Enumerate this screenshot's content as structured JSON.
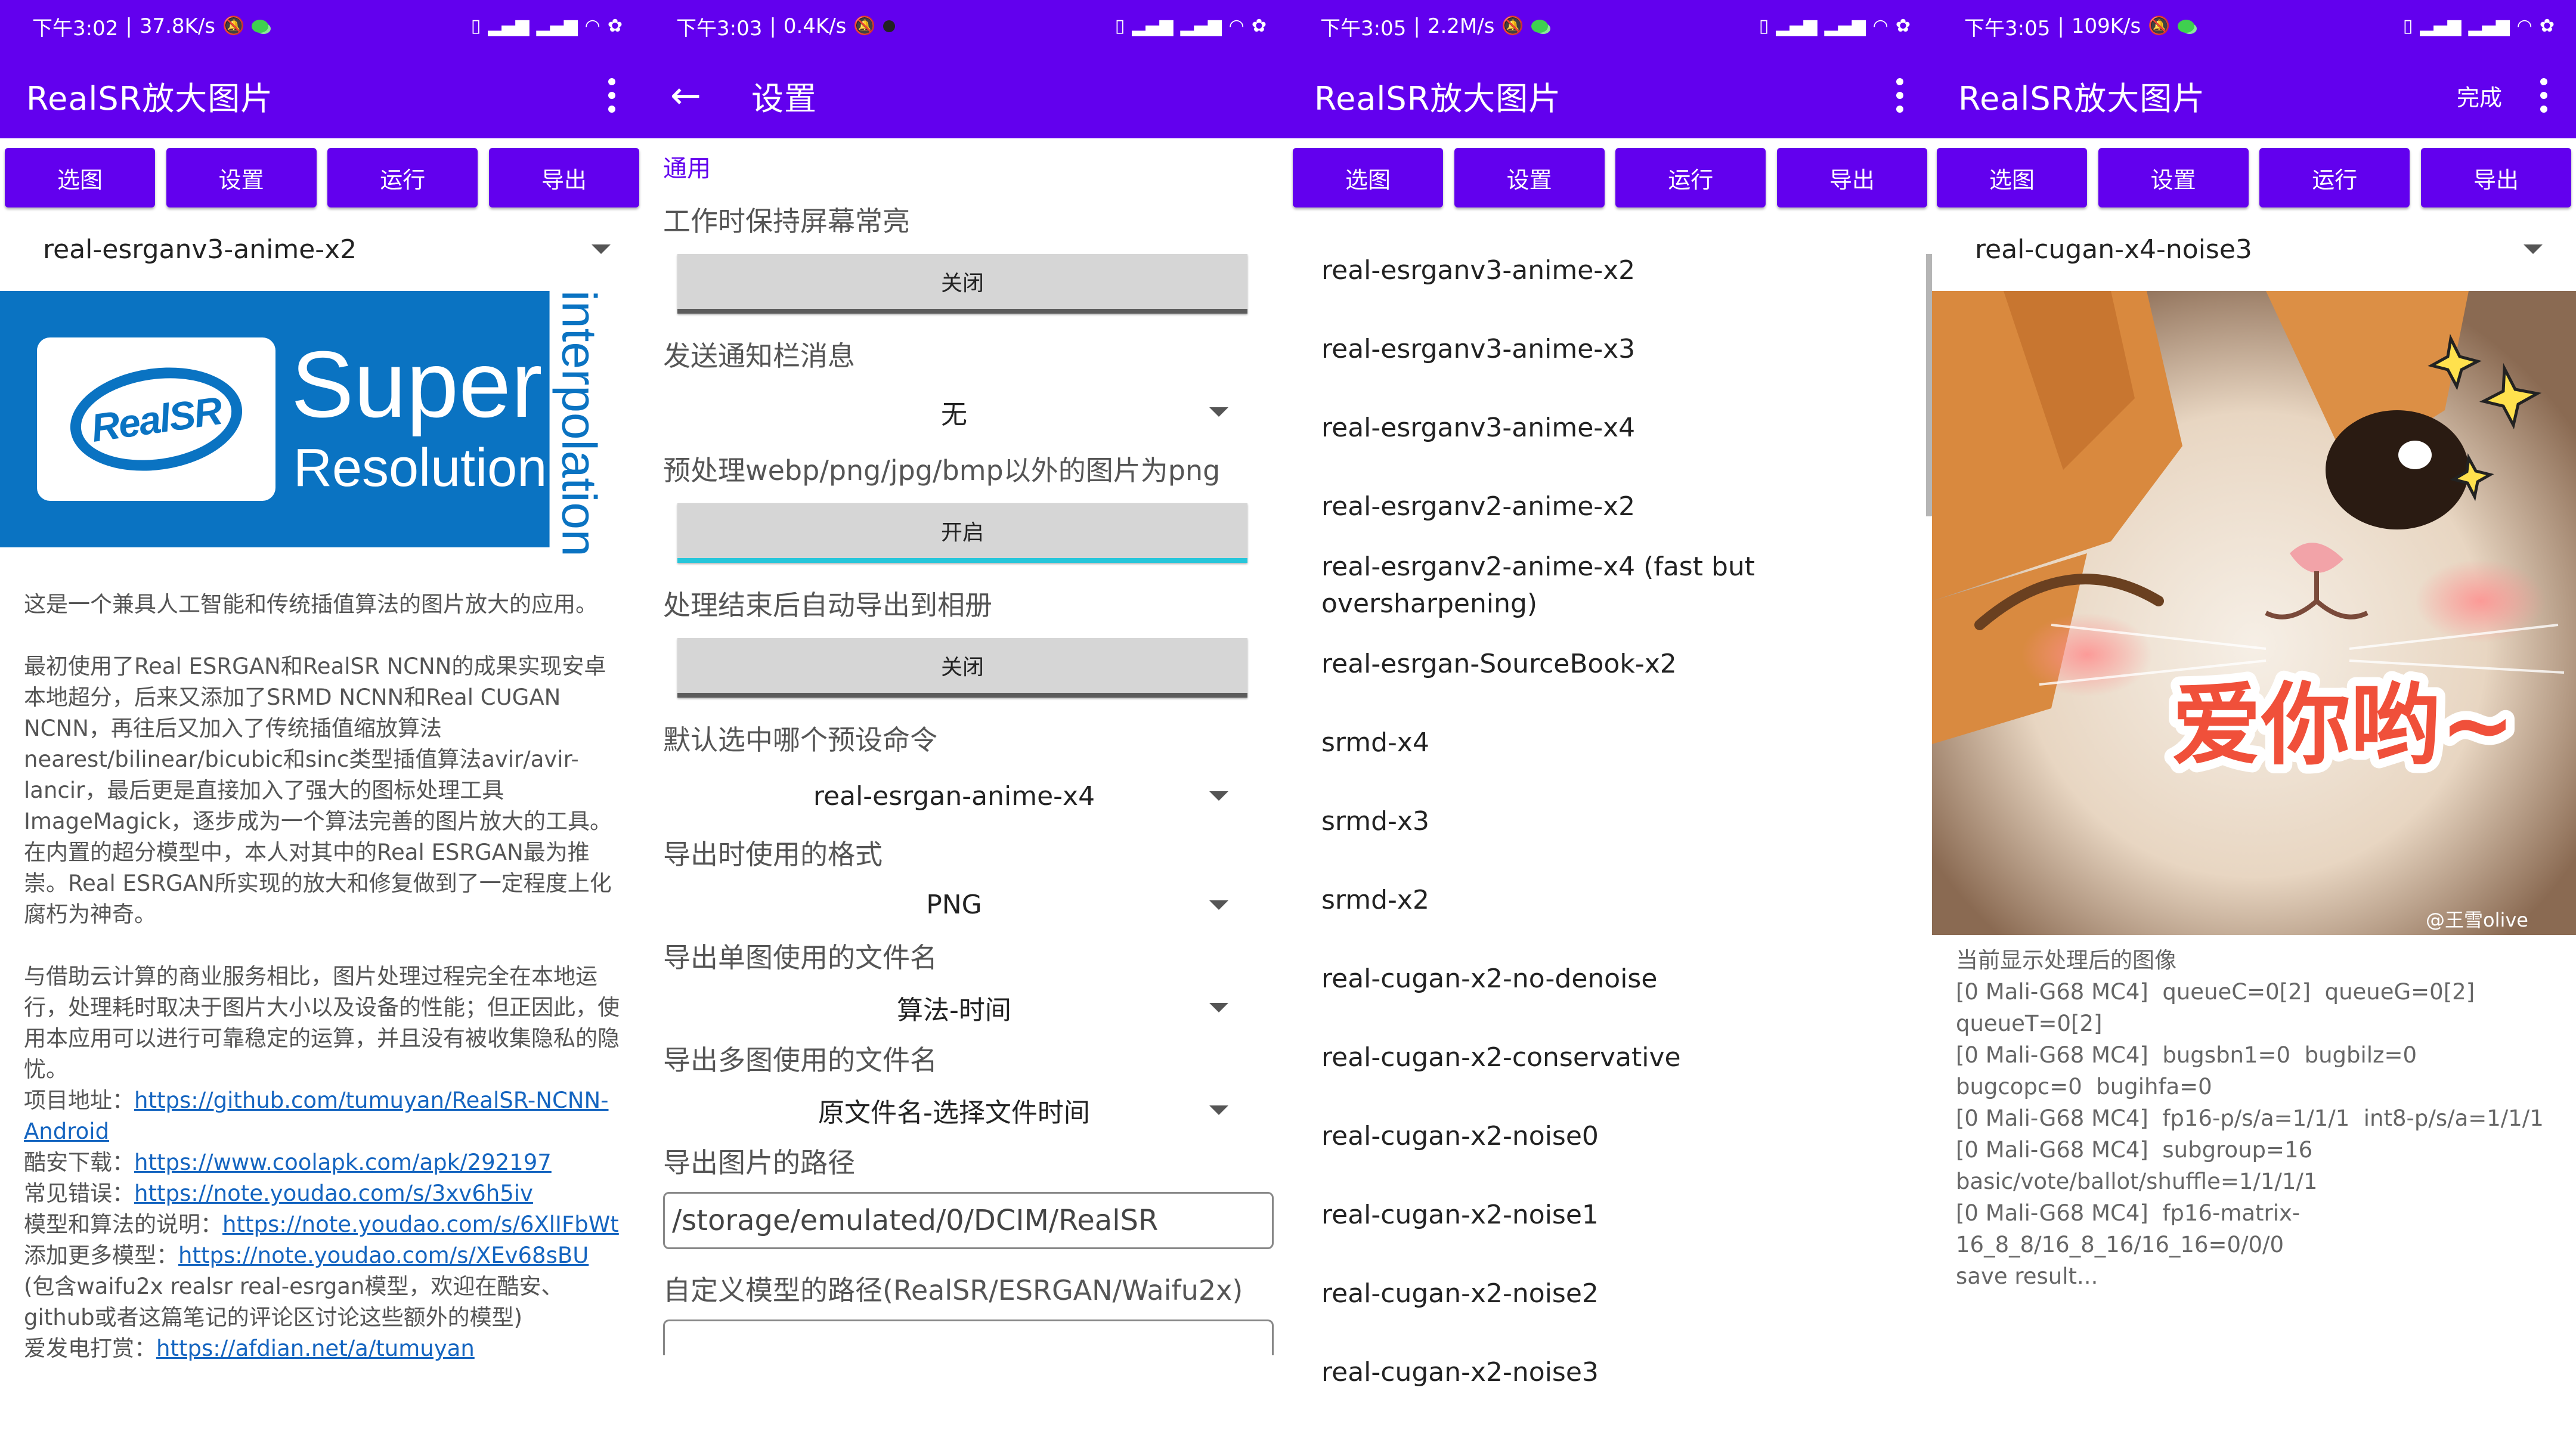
{
  "colors": {
    "primary": "#6200ee",
    "logo_blue": "#0a73c2",
    "link": "#1565c0",
    "toggle_on": "#26c6da"
  },
  "screen1": {
    "status": {
      "time": "下午3:02",
      "speed": "37.8K/s"
    },
    "appbar": {
      "title": "RealSR放大图片"
    },
    "buttons": [
      "选图",
      "设置",
      "运行",
      "导出"
    ],
    "model": "real-esrganv3-anime-x2",
    "logo": {
      "brand": "RealSR",
      "line1": "Super",
      "line2": "Resolution",
      "side": "interpolation"
    },
    "desc": {
      "p1": "这是一个兼具人工智能和传统插值算法的图片放大的应用。",
      "p2a": "最初使用了Real ESRGAN和RealSR NCNN的成果实现安卓本地超分，后来又添加了SRMD NCNN和Real CUGAN NCNN，再往后又加入了传统插值缩放算法nearest/bilinear/bicubic和sinc类型插值算法avir/avir-lancir，最后更是直接加入了强大的图标处理工具ImageMagick，逐步成为一个算法完善的图片放大的工具。",
      "p2b": "在内置的超分模型中，本人对其中的Real ESRGAN最为推崇。Real ESRGAN所实现的放大和修复做到了一定程度上化腐朽为神奇。",
      "p3": "与借助云计算的商业服务相比，图片处理过程完全在本地运行，处理耗时取决于图片大小以及设备的性能；但正因此，使用本应用可以进行可靠稳定的运算，并且没有被收集隐私的隐忧。",
      "l1_label": "项目地址：",
      "l1_url": "https://github.com/tumuyan/RealSR-NCNN-Android",
      "l2_label": "酷安下载：",
      "l2_url": "https://www.coolapk.com/apk/292197",
      "l3_label": "常见错误：",
      "l3_url": "https://note.youdao.com/s/3xv6h5iv",
      "l4_label": "模型和算法的说明：",
      "l4_url": "https://note.youdao.com/s/6XlIFbWt",
      "l5_label": "添加更多模型：",
      "l5_url": "https://note.youdao.com/s/XEv68sBU",
      "p4": "(包含waifu2x realsr real-esrgan模型，欢迎在酷安、github或者这篇笔记的评论区讨论这些额外的模型)",
      "l6_label": "爱发电打赏：",
      "l6_url": "https://afdian.net/a/tumuyan"
    }
  },
  "screen2": {
    "status": {
      "time": "下午3:03",
      "speed": "0.4K/s"
    },
    "appbar": {
      "title": "设置"
    },
    "category": "通用",
    "items": {
      "keep_screen": {
        "title": "工作时保持屏幕常亮",
        "value": "关闭"
      },
      "notify": {
        "title": "发送通知栏消息",
        "value": "无"
      },
      "preprocess": {
        "title": "预处理webp/png/jpg/bmp以外的图片为png",
        "value": "开启"
      },
      "auto_export": {
        "title": "处理结束后自动导出到相册",
        "value": "关闭"
      },
      "default_cmd": {
        "title": "默认选中哪个预设命令",
        "value": "real-esrgan-anime-x4"
      },
      "export_format": {
        "title": "导出时使用的格式",
        "value": "PNG"
      },
      "single_name": {
        "title": "导出单图使用的文件名",
        "value": "算法-时间"
      },
      "multi_name": {
        "title": "导出多图使用的文件名",
        "value": "原文件名-选择文件时间"
      },
      "export_path": {
        "title": "导出图片的路径",
        "value": "/storage/emulated/0/DCIM/RealSR"
      },
      "custom_path": {
        "title": "自定义模型的路径(RealSR/ESRGAN/Waifu2x)"
      }
    }
  },
  "screen3": {
    "status": {
      "time": "下午3:05",
      "speed": "2.2M/s"
    },
    "appbar": {
      "title": "RealSR放大图片"
    },
    "buttons": [
      "选图",
      "设置",
      "运行",
      "导出"
    ],
    "models": [
      "real-esrganv3-anime-x2",
      "real-esrganv3-anime-x3",
      "real-esrganv3-anime-x4",
      "real-esrganv2-anime-x2",
      "real-esrganv2-anime-x4 (fast but oversharpening)",
      "real-esrgan-SourceBook-x2",
      "srmd-x4",
      "srmd-x3",
      "srmd-x2",
      "real-cugan-x2-no-denoise",
      "real-cugan-x2-conservative",
      "real-cugan-x2-noise0",
      "real-cugan-x2-noise1",
      "real-cugan-x2-noise2",
      "real-cugan-x2-noise3"
    ]
  },
  "screen4": {
    "status": {
      "time": "下午3:05",
      "speed": "109K/s"
    },
    "appbar": {
      "title": "RealSR放大图片",
      "done": "完成"
    },
    "buttons": [
      "选图",
      "设置",
      "运行",
      "导出"
    ],
    "model": "real-cugan-x4-noise3",
    "image": {
      "caption": "爱你哟~",
      "watermark": "@王雪olive"
    },
    "log": "当前显示处理后的图像\n[0 Mali-G68 MC4]  queueC=0[2]  queueG=0[2]  queueT=0[2]\n[0 Mali-G68 MC4]  bugsbn1=0  bugbilz=0  bugcopc=0  bugihfa=0\n[0 Mali-G68 MC4]  fp16-p/s/a=1/1/1  int8-p/s/a=1/1/1\n[0 Mali-G68 MC4]  subgroup=16  basic/vote/ballot/shuffle=1/1/1/1\n[0 Mali-G68 MC4]  fp16-matrix-16_8_8/16_8_16/16_16=0/0/0\nsave result..."
  }
}
